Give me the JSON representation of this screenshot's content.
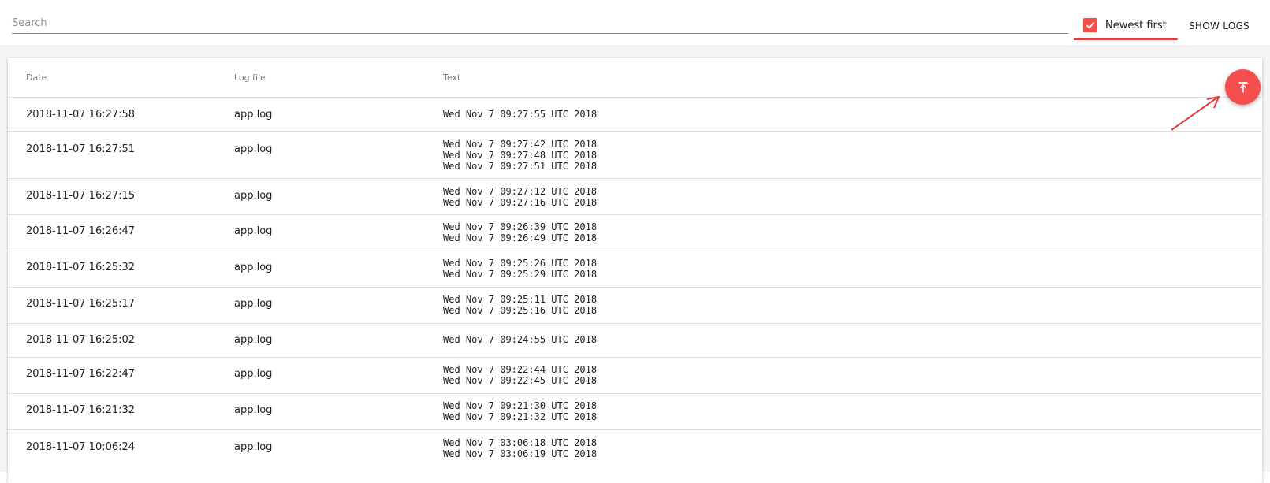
{
  "toolbar": {
    "search_placeholder": "Search",
    "search_value": "",
    "newest_first_label": "Newest first",
    "newest_first_checked": true,
    "show_logs_label": "SHOW LOGS"
  },
  "table": {
    "columns": [
      "Date",
      "Log file",
      "Text"
    ],
    "rows": [
      {
        "date": "2018-11-07 16:27:58",
        "file": "app.log",
        "text": "Wed Nov 7 09:27:55 UTC 2018"
      },
      {
        "date": "2018-11-07 16:27:51",
        "file": "app.log",
        "text": "Wed Nov 7 09:27:42 UTC 2018\nWed Nov 7 09:27:48 UTC 2018\nWed Nov 7 09:27:51 UTC 2018"
      },
      {
        "date": "2018-11-07 16:27:15",
        "file": "app.log",
        "text": "Wed Nov 7 09:27:12 UTC 2018\nWed Nov 7 09:27:16 UTC 2018"
      },
      {
        "date": "2018-11-07 16:26:47",
        "file": "app.log",
        "text": "Wed Nov 7 09:26:39 UTC 2018\nWed Nov 7 09:26:49 UTC 2018"
      },
      {
        "date": "2018-11-07 16:25:32",
        "file": "app.log",
        "text": "Wed Nov 7 09:25:26 UTC 2018\nWed Nov 7 09:25:29 UTC 2018"
      },
      {
        "date": "2018-11-07 16:25:17",
        "file": "app.log",
        "text": "Wed Nov 7 09:25:11 UTC 2018\nWed Nov 7 09:25:16 UTC 2018"
      },
      {
        "date": "2018-11-07 16:25:02",
        "file": "app.log",
        "text": "Wed Nov 7 09:24:55 UTC 2018"
      },
      {
        "date": "2018-11-07 16:22:47",
        "file": "app.log",
        "text": "Wed Nov 7 09:22:44 UTC 2018\nWed Nov 7 09:22:45 UTC 2018"
      },
      {
        "date": "2018-11-07 16:21:32",
        "file": "app.log",
        "text": "Wed Nov 7 09:21:30 UTC 2018\nWed Nov 7 09:21:32 UTC 2018"
      },
      {
        "date": "2018-11-07 10:06:24",
        "file": "app.log",
        "text": "Wed Nov 7 03:06:18 UTC 2018\nWed Nov 7 03:06:19 UTC 2018"
      }
    ]
  },
  "fab": {
    "icon": "scroll-to-top-icon"
  },
  "colors": {
    "accent": "#f44e4f",
    "annotation": "#e03a3c",
    "divider": "#e0e0e0"
  }
}
